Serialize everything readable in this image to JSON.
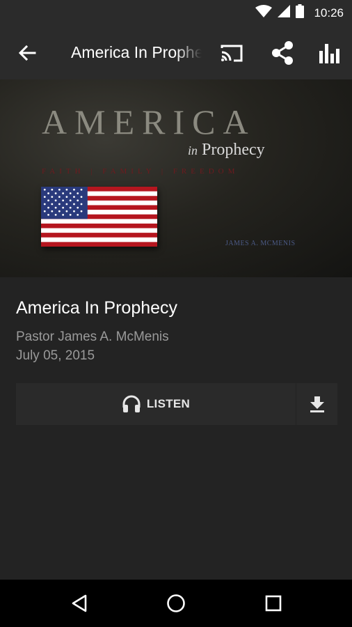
{
  "status_bar": {
    "time": "10:26",
    "icons": [
      "wifi-icon",
      "cell-signal-icon",
      "battery-icon"
    ]
  },
  "app_bar": {
    "title": "America In Prophecy",
    "actions": [
      "cast-icon",
      "share-icon",
      "bar-chart-icon"
    ]
  },
  "artwork": {
    "title": "AMERICA",
    "subtitle_in": "in",
    "subtitle_word": "Prophecy",
    "tagline": "FAITH | FAMILY | FREEDOM",
    "author": "JAMES A. MCMENIS"
  },
  "sermon": {
    "title": "America In Prophecy",
    "speaker": "Pastor James A. McMenis",
    "date": "July 05, 2015"
  },
  "actions": {
    "listen_label": "LISTEN"
  },
  "nav_bar": {
    "buttons": [
      "back-triangle-icon",
      "home-circle-icon",
      "recents-square-icon"
    ]
  },
  "colors": {
    "background": "#232323",
    "app_bar": "#2b2b2b",
    "secondary_text": "#9a9a9a",
    "button_bg": "#2a2a2a"
  }
}
